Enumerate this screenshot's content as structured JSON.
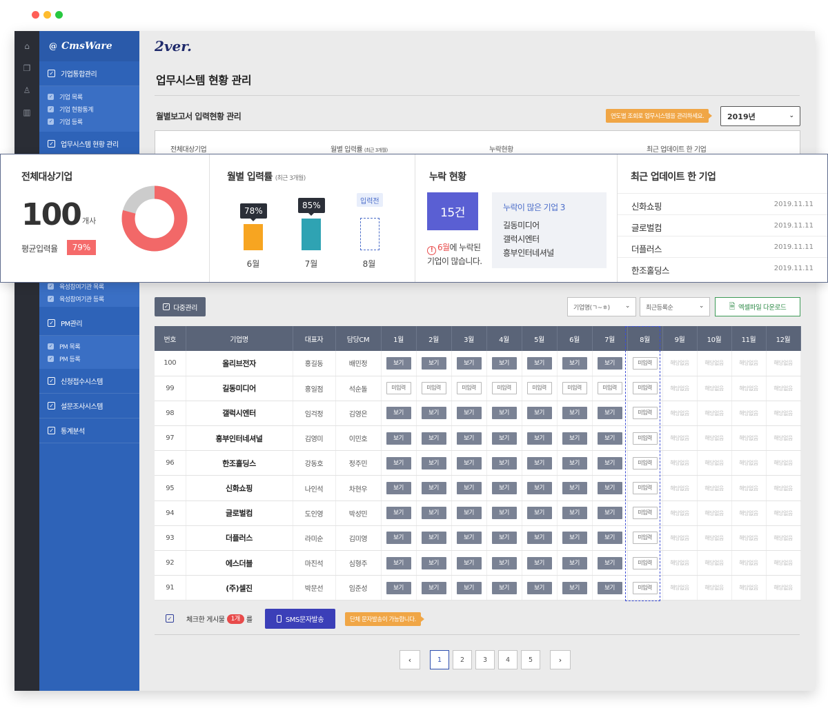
{
  "window": {
    "dots": [
      "#ff5f57",
      "#febc2e",
      "#28c840"
    ]
  },
  "iconbar": {
    "icons": [
      "home-icon",
      "copy-icon",
      "user-icon",
      "bar-chart-icon"
    ]
  },
  "sidebar": {
    "logo": "CmsWare",
    "sections": [
      {
        "label": "기업통합관리",
        "items": [
          "기업 목록",
          "기업 현황통계",
          "기업 등록"
        ]
      },
      {
        "label": "업무시스템 현황 관리",
        "items": []
      }
    ],
    "hidden_tail_items": [
      "육성참여기관 목록",
      "육성참여기관 등록"
    ],
    "lower_sections": [
      {
        "label": "PM관리",
        "items": [
          "PM 목록",
          "PM 등록"
        ]
      },
      {
        "label": "신청접수시스템",
        "items": []
      },
      {
        "label": "설문조사시스템",
        "items": []
      },
      {
        "label": "통계분석",
        "items": []
      }
    ]
  },
  "header": {
    "brand": "2ver.",
    "page_title": "업무시스템 현황 관리"
  },
  "monthly": {
    "subtitle": "월별보고서 입력현황 관리",
    "tip": "연도별 조회로 업무시스템을 관리하세요.",
    "year": "2019년"
  },
  "under_heads": [
    "전체대상기업",
    "월별 입력률",
    "(최근 3개월)",
    "누락현황",
    "최근 업데이트 한 기업"
  ],
  "summary": {
    "total": {
      "title": "전체대상기업",
      "count": "100",
      "unit": "개사",
      "avg_label": "평균입력율",
      "avg_value": "79%",
      "avg_fraction": 0.79
    },
    "rate": {
      "title": "월별 입력률",
      "subtitle": "(최근 3개월)",
      "bars": [
        {
          "label": "6월",
          "value_text": "78%",
          "value": 78,
          "color": "#f7a521"
        },
        {
          "label": "7월",
          "value_text": "85%",
          "value": 85,
          "color": "#2fa3b3"
        },
        {
          "label": "8월",
          "value_text": "입력전",
          "value": null,
          "color": "#4a6cc9"
        }
      ]
    },
    "missing": {
      "title": "누락 현황",
      "count": "15건",
      "note_month": "6월",
      "note_rest_1": "에 누락된",
      "note_rest_2": "기업이 많습니다.",
      "many_title": "누락이 많은 기업 3",
      "many_items": [
        "길동미디어",
        "갤럭시엔터",
        "흥부인터네셔널"
      ]
    },
    "recent": {
      "title": "최근 업데이트 한 기업",
      "items": [
        {
          "name": "신화쇼핑",
          "date": "2019.11.11"
        },
        {
          "name": "글로벌컴",
          "date": "2019.11.11"
        },
        {
          "name": "더플러스",
          "date": "2019.11.11"
        },
        {
          "name": "한조홀딩스",
          "date": "2019.11.11"
        }
      ]
    }
  },
  "toolbar": {
    "multi": "다중관리",
    "sort_name": "기업명(ㄱ~ㅎ)",
    "sort_recent": "최근등록순",
    "excel": "엑셀파일 다운로드"
  },
  "table": {
    "headers": [
      "번호",
      "기업명",
      "대표자",
      "담당CM",
      "1월",
      "2월",
      "3월",
      "4월",
      "5월",
      "6월",
      "7월",
      "8월",
      "9월",
      "10월",
      "11월",
      "12월"
    ],
    "labels": {
      "view": "보기",
      "none": "미입력",
      "na": "해당없음"
    },
    "rows": [
      {
        "no": "100",
        "name": "올리브전자",
        "ceo": "홍길동",
        "cm": "배민정",
        "months": [
          "v",
          "v",
          "v",
          "v",
          "v",
          "v",
          "v",
          "n",
          "x",
          "x",
          "x",
          "x"
        ]
      },
      {
        "no": "99",
        "name": "길동미디어",
        "ceo": "홍일점",
        "cm": "석순돌",
        "months": [
          "n",
          "n",
          "n",
          "n",
          "n",
          "n",
          "n",
          "n",
          "x",
          "x",
          "x",
          "x"
        ]
      },
      {
        "no": "98",
        "name": "갤럭시엔터",
        "ceo": "임걱정",
        "cm": "김영은",
        "months": [
          "v",
          "v",
          "v",
          "v",
          "v",
          "v",
          "v",
          "n",
          "x",
          "x",
          "x",
          "x"
        ]
      },
      {
        "no": "97",
        "name": "흥부인터네셔널",
        "ceo": "김영미",
        "cm": "이민호",
        "months": [
          "v",
          "v",
          "v",
          "v",
          "v",
          "v",
          "v",
          "n",
          "x",
          "x",
          "x",
          "x"
        ]
      },
      {
        "no": "96",
        "name": "한조홀딩스",
        "ceo": "강동호",
        "cm": "정주민",
        "months": [
          "v",
          "v",
          "v",
          "v",
          "v",
          "v",
          "v",
          "n",
          "x",
          "x",
          "x",
          "x"
        ]
      },
      {
        "no": "95",
        "name": "신화쇼핑",
        "ceo": "나인석",
        "cm": "차현우",
        "months": [
          "v",
          "v",
          "v",
          "v",
          "v",
          "v",
          "v",
          "n",
          "x",
          "x",
          "x",
          "x"
        ]
      },
      {
        "no": "94",
        "name": "글로벌컴",
        "ceo": "도인영",
        "cm": "박성민",
        "months": [
          "v",
          "v",
          "v",
          "v",
          "v",
          "v",
          "v",
          "n",
          "x",
          "x",
          "x",
          "x"
        ]
      },
      {
        "no": "93",
        "name": "더플러스",
        "ceo": "라미순",
        "cm": "김미영",
        "months": [
          "v",
          "v",
          "v",
          "v",
          "v",
          "v",
          "v",
          "n",
          "x",
          "x",
          "x",
          "x"
        ]
      },
      {
        "no": "92",
        "name": "에스더블",
        "ceo": "마진석",
        "cm": "심형주",
        "months": [
          "v",
          "v",
          "v",
          "v",
          "v",
          "v",
          "v",
          "n",
          "x",
          "x",
          "x",
          "x"
        ]
      },
      {
        "no": "91",
        "name": "(주)셀진",
        "ceo": "박문선",
        "cm": "임준성",
        "months": [
          "v",
          "v",
          "v",
          "v",
          "v",
          "v",
          "v",
          "n",
          "x",
          "x",
          "x",
          "x"
        ]
      }
    ]
  },
  "footer": {
    "checked_label_pre": "체크한 게시물",
    "checked_count": "1개",
    "checked_label_post": "를",
    "sms": "SMS문자발송",
    "sms_tip": "단체 문자발송이 가능합니다."
  },
  "pagination": {
    "pages": [
      "1",
      "2",
      "3",
      "4",
      "5"
    ],
    "active": "1"
  }
}
